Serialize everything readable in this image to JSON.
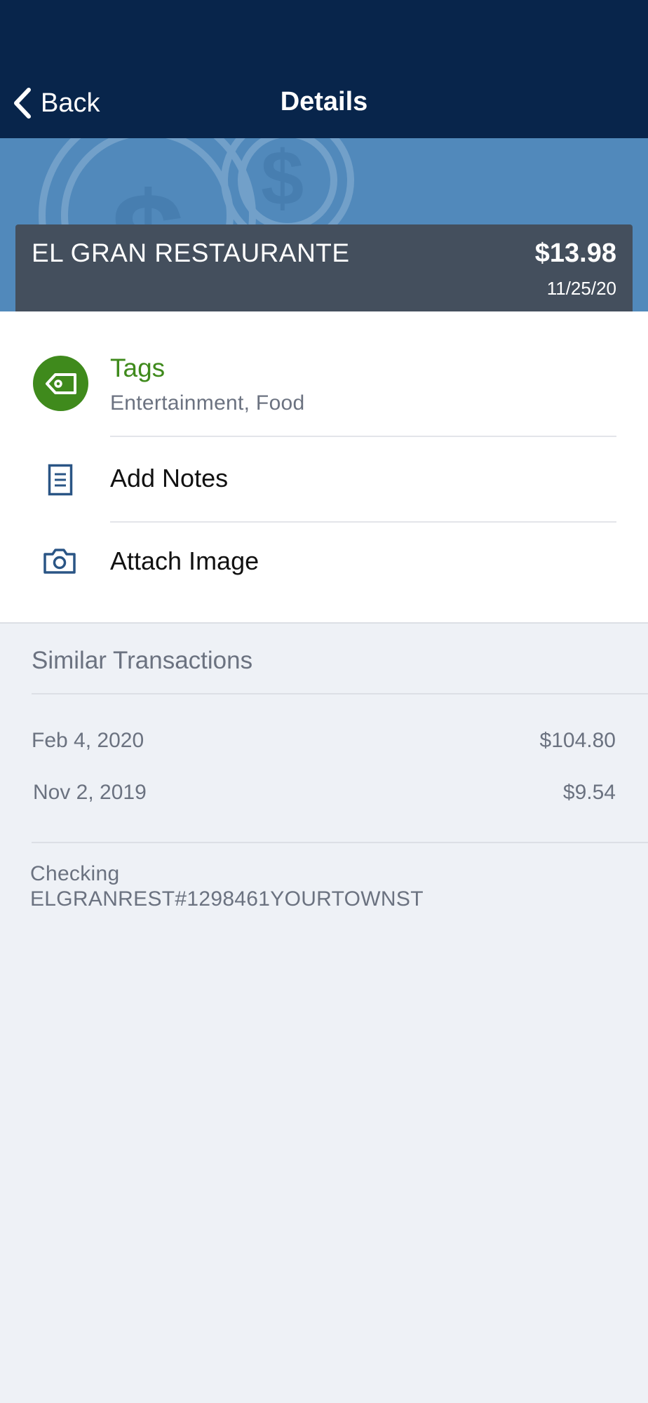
{
  "nav": {
    "back_label": "Back",
    "title": "Details"
  },
  "transaction": {
    "merchant": "EL GRAN RESTAURANTE",
    "amount": "$13.98",
    "date": "11/25/20"
  },
  "actions": {
    "tags_title": "Tags",
    "tags_value": "Entertainment, Food",
    "add_notes": "Add Notes",
    "attach_image": "Attach Image"
  },
  "similar": {
    "title": "Similar Transactions",
    "items": [
      {
        "date": "Feb 4, 2020",
        "amount": "$104.80"
      },
      {
        "date": "Nov 2, 2019",
        "amount": "$9.54"
      }
    ]
  },
  "account": {
    "type": "Checking",
    "description": "ELGRANREST#1298461YOURTOWNST"
  },
  "colors": {
    "nav": "#08254b",
    "banner": "#5189bb",
    "card": "#444f5d",
    "accent_green": "#3f8a1c",
    "icon_blue": "#2a5585",
    "page_bg": "#eef1f6"
  },
  "icons": [
    "chevron-left-icon",
    "dollar-coin-icon",
    "tag-icon",
    "document-icon",
    "camera-icon"
  ]
}
